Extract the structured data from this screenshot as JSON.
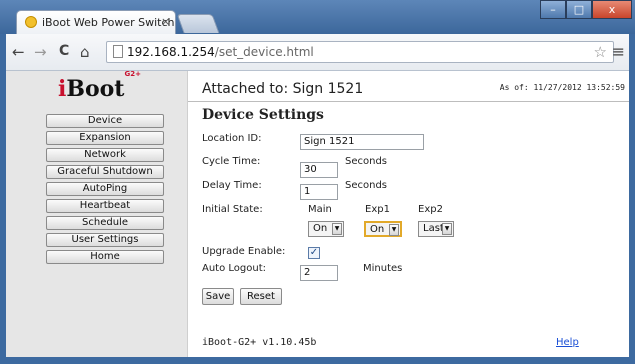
{
  "browser": {
    "tab_title": "iBoot Web Power Switch",
    "tab_close": "×",
    "url_host": "192.168.1.254",
    "url_path": "/set_device.html",
    "nav_back": "←",
    "nav_forward": "→",
    "nav_reload": "C",
    "nav_home": "⌂",
    "star": "☆",
    "menu": "≡",
    "win_min": "–",
    "win_max": "□",
    "win_close": "x"
  },
  "logo": {
    "text": "Boot",
    "i": "i",
    "sup": "G2+"
  },
  "sidebar": {
    "items": [
      {
        "label": "Device"
      },
      {
        "label": "Expansion"
      },
      {
        "label": "Network"
      },
      {
        "label": "Graceful Shutdown"
      },
      {
        "label": "AutoPing"
      },
      {
        "label": "Heartbeat"
      },
      {
        "label": "Schedule"
      },
      {
        "label": "User Settings"
      },
      {
        "label": "Home"
      }
    ]
  },
  "header": {
    "attached": "Attached to: Sign 1521",
    "as_of": "As of: 11/27/2012 13:52:59"
  },
  "form": {
    "title": "Device Settings",
    "location_label": "Location ID:",
    "location_value": "Sign 1521",
    "cycle_label": "Cycle Time:",
    "cycle_value": "30",
    "cycle_unit": "Seconds",
    "delay_label": "Delay Time:",
    "delay_value": "1",
    "delay_unit": "Seconds",
    "initial_label": "Initial State:",
    "columns": [
      "Main",
      "Exp1",
      "Exp2"
    ],
    "selects": [
      "On",
      "On",
      "Last"
    ],
    "upgrade_label": "Upgrade Enable:",
    "upgrade_checked": "✓",
    "logout_label": "Auto Logout:",
    "logout_value": "2",
    "logout_unit": "Minutes",
    "save": "Save",
    "reset": "Reset"
  },
  "footer": {
    "version": "iBoot-G2+ v1.10.45b",
    "help": "Help"
  }
}
